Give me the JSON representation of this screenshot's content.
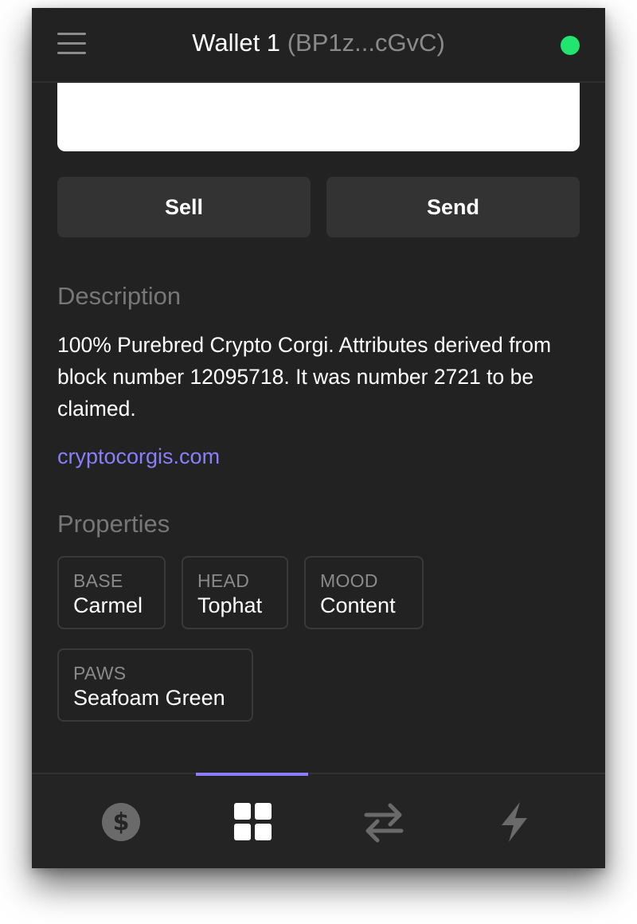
{
  "header": {
    "wallet_name": "Wallet 1",
    "wallet_address": "(BP1z...cGvC)",
    "status_color": "#21e56f"
  },
  "actions": {
    "sell_label": "Sell",
    "send_label": "Send"
  },
  "description": {
    "heading": "Description",
    "text": "100% Purebred Crypto Corgi. Attributes derived from block number 12095718. It was number 2721 to be claimed.",
    "link_text": "cryptocorgis.com"
  },
  "properties": {
    "heading": "Properties",
    "items": [
      {
        "key": "BASE",
        "value": "Carmel"
      },
      {
        "key": "HEAD",
        "value": "Tophat"
      },
      {
        "key": "MOOD",
        "value": "Content"
      },
      {
        "key": "PAWS",
        "value": "Seafoam Green"
      }
    ]
  },
  "bottom_nav": {
    "items": [
      {
        "icon": "dollar-coin-icon",
        "active": false
      },
      {
        "icon": "grid-icon",
        "active": true
      },
      {
        "icon": "swap-arrows-icon",
        "active": false
      },
      {
        "icon": "lightning-icon",
        "active": false
      }
    ],
    "accent_color": "#8c7dfa"
  }
}
